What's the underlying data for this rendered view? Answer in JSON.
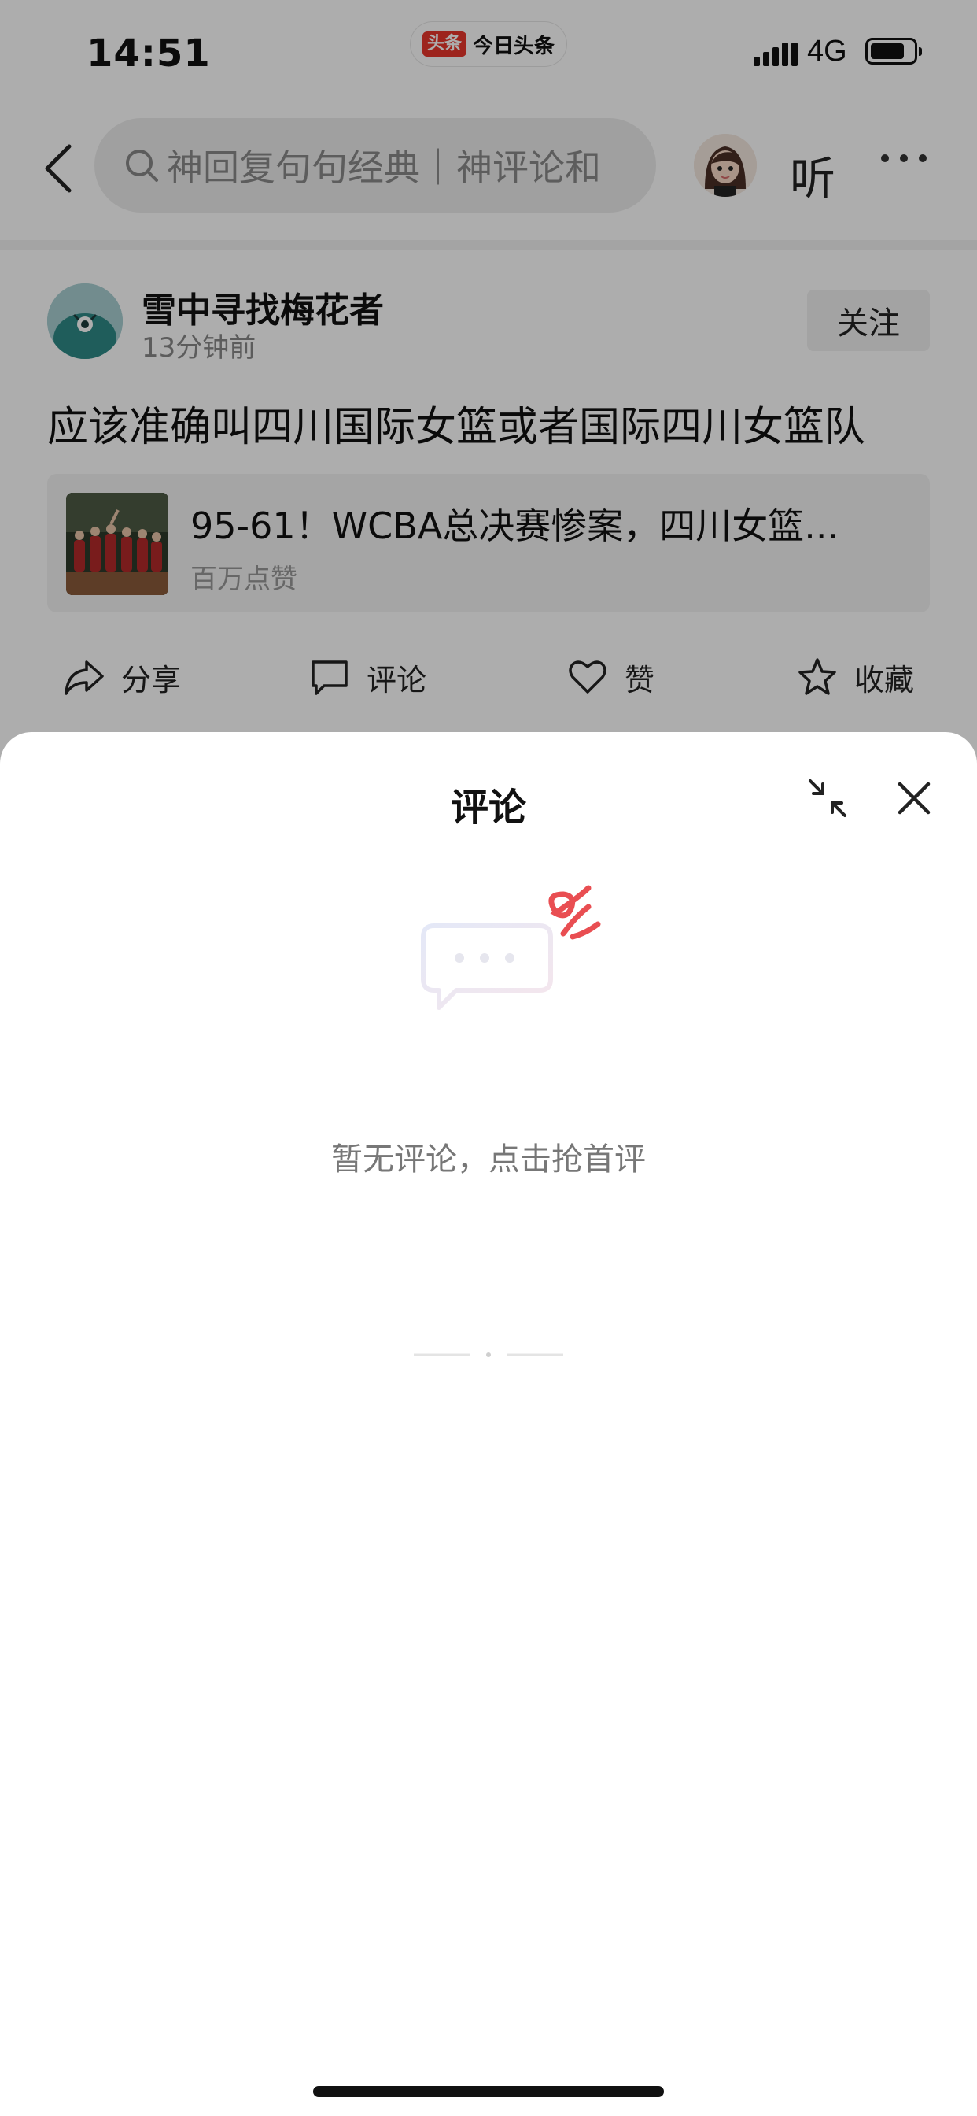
{
  "status_bar": {
    "time": "14:51",
    "app_logo": "头条",
    "app_name": "今日头条",
    "network": "4G",
    "battery_level": 0.8
  },
  "nav": {
    "back_icon": "chevron-left-icon",
    "search_placeholder": "神回复句句经典｜神评论和",
    "listen_label": "听",
    "more_icon": "more-horizontal-icon"
  },
  "post": {
    "author_name": "雪中寻找梅花者",
    "time_ago": "13分钟前",
    "follow_label": "关注",
    "text": "应该准确叫四川国际女篮或者国际四川女篮队",
    "linked_article": {
      "title": "95-61！WCBA总决赛惨案，四川女篮...",
      "meta": "百万点赞"
    },
    "actions": [
      {
        "icon": "share-icon",
        "label": "分享"
      },
      {
        "icon": "comment-icon",
        "label": "评论"
      },
      {
        "icon": "heart-icon",
        "label": "赞"
      },
      {
        "icon": "star-icon",
        "label": "收藏"
      }
    ]
  },
  "comment_sheet": {
    "title": "评论",
    "collapse_icon": "collapse-icon",
    "close_icon": "close-icon",
    "empty_text": "暂无评论，点击抢首评"
  },
  "colors": {
    "brand_red": "#e8362c",
    "dim_overlay": "rgba(0,0,0,0.32)"
  }
}
